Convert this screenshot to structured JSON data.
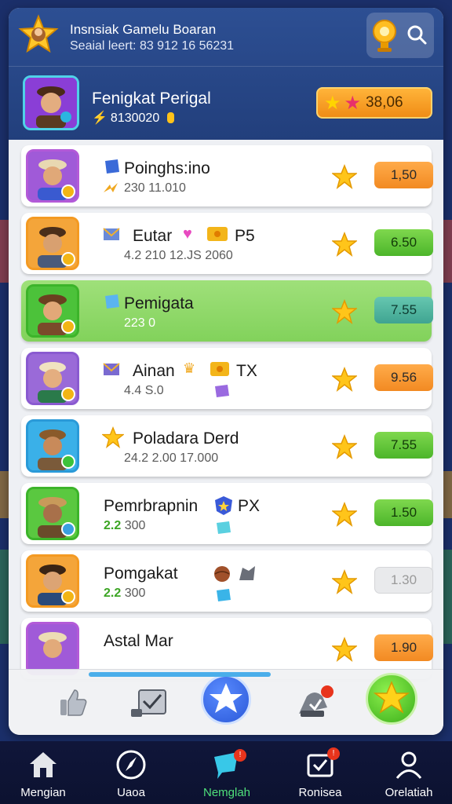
{
  "header": {
    "title": "Insnsiak Gamelu Boaran",
    "subtitle": "Seaial leert: 83  912 16 56231"
  },
  "player": {
    "name": "Fenigkat Perigal",
    "meta": "8130020",
    "score": "38,06"
  },
  "leaderboard": [
    {
      "name": "Poinghs:ino",
      "stats": "230  11.010",
      "value": "1,50",
      "value_style": "orange"
    },
    {
      "name": "Eutar",
      "tag": "P5",
      "stats": "4.2  210  12.JS 2060",
      "value": "6.50",
      "value_style": "green"
    },
    {
      "name": "Pemigata",
      "stats": "223  0",
      "value": "7.55",
      "value_style": "teal",
      "highlighted": true
    },
    {
      "name": "Ainan",
      "tag": "TX",
      "stats": "4.4  S.0",
      "value": "9.56",
      "value_style": "orange"
    },
    {
      "name": "Poladara Derd",
      "stats": "24.2  2.00  17.000",
      "value": "7.55",
      "value_style": "green"
    },
    {
      "name": "Pemrbrapnin",
      "tag": "PX",
      "stats_accent": "2.2",
      "stats": "300",
      "value": "1.50",
      "value_style": "green"
    },
    {
      "name": "Pomgakat",
      "stats_accent": "2.2",
      "stats": "300",
      "value": "1.30",
      "value_style": "gray"
    },
    {
      "name": "Astal Mar",
      "stats": "",
      "value": "1.90",
      "value_style": "orange"
    }
  ],
  "tabs": [
    {
      "label": "Mengian",
      "icon": "home-icon"
    },
    {
      "label": "Uaoa",
      "icon": "compass-icon"
    },
    {
      "label": "Nemglah",
      "icon": "chat-icon",
      "active": true,
      "badge": "!"
    },
    {
      "label": "Ronisea",
      "icon": "inbox-icon",
      "badge": "!"
    },
    {
      "label": "Orelatiah",
      "icon": "profile-icon"
    }
  ],
  "colors": {
    "header_bg": "#2d4f93",
    "accent_green": "#4cb52a",
    "accent_orange": "#f28a22",
    "tab_active": "#4fe07a"
  }
}
